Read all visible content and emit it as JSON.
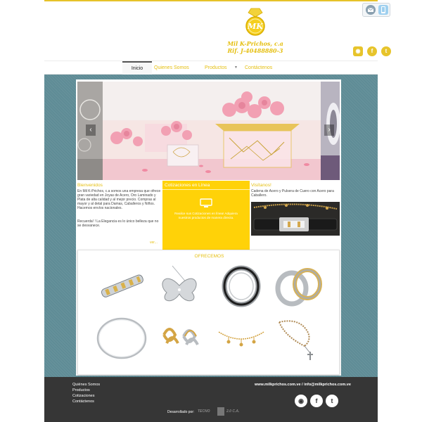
{
  "header": {
    "logo_line1": "Mil K-Prichos, c.a",
    "logo_line2": "Rif. J-40488880-3",
    "logo_monogram": "MK"
  },
  "nav": {
    "items": [
      {
        "label": "Inicio"
      },
      {
        "label": "Quienes Somos"
      },
      {
        "label": "Productos"
      },
      {
        "label": "Contáctenos"
      }
    ]
  },
  "columns": {
    "bienvenidos": {
      "title": "Bienvenidos",
      "text": "En Mil K-Prichos, c.a somos una empresa que ofrece gran variedad en Joyas de Acero, Oro Laminado y Plata de alta calidad y al mejor precio. Compras al mayor y al detal para Damas, Caballeros y Niños. Hacemos envíos nacionales.",
      "extra": "Recuerda! ! La Elegancia es lo único belleza que no se desvanece.",
      "more": "ver..."
    },
    "cotizaciones": {
      "title": "Cotizaciones en Línea",
      "text": "Realice sus Cotizaciones en línea! Adquiera nuestros productos de manera directa."
    },
    "visitanos": {
      "title": "Visítanos!",
      "text": "Cadena de Acero y Pulsera de Cuero con Acero para Caballero."
    }
  },
  "ofrecemos": {
    "title": "OFRECEMOS"
  },
  "footer": {
    "links": [
      {
        "label": "Quiénes Somos"
      },
      {
        "label": "Productos"
      },
      {
        "label": "Cotizaciones"
      },
      {
        "label": "Contáctenos"
      }
    ],
    "contact": "www.milkprichos.com.ve / info@milkprichos.com.ve",
    "developed_by": "Desarrollado por:",
    "dev_name_left": "TECNO",
    "dev_name_right": "2.0 C.A."
  },
  "colors": {
    "accent": "#e5bf10",
    "yellow_box": "#ffd208",
    "background": "#5f8c96",
    "footer": "#363636"
  }
}
